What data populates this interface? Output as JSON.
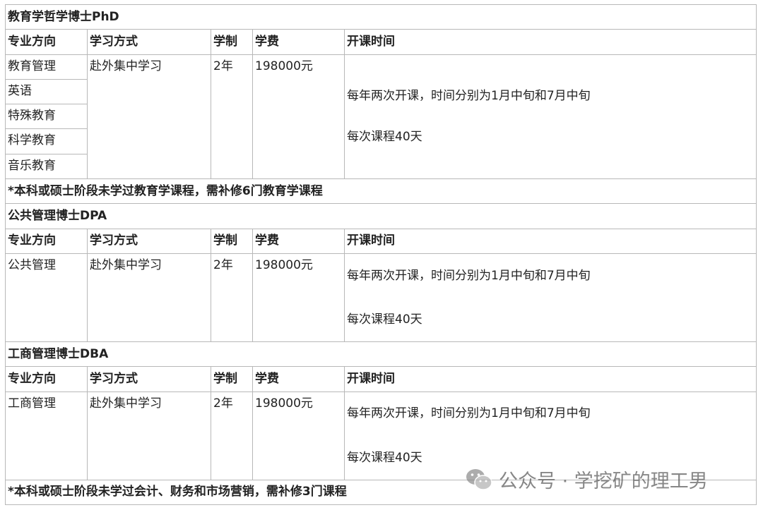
{
  "columns": [
    "专业方向",
    "学习方式",
    "学制",
    "学费",
    "开课时间"
  ],
  "sections": [
    {
      "title": "教育学哲学博士PhD",
      "majors": [
        "教育管理",
        "英语",
        "特殊教育",
        "科学教育",
        "音乐教育"
      ],
      "mode": "赴外集中学习",
      "duration": "2年",
      "fee": "198000元",
      "schedule": [
        "每年两次开课，时间分别为1月中旬和7月中旬",
        "每次课程40天"
      ],
      "note": "*本科或硕士阶段未学过教育学课程，需补修6门教育学课程"
    },
    {
      "title": "公共管理博士DPA",
      "majors": [
        "公共管理"
      ],
      "mode": "赴外集中学习",
      "duration": "2年",
      "fee": "198000元",
      "schedule": [
        "每年两次开课，时间分别为1月中旬和7月中旬",
        "每次课程40天"
      ]
    },
    {
      "title": "工商管理博士DBA",
      "majors": [
        "工商管理"
      ],
      "mode": "赴外集中学习",
      "duration": "2年",
      "fee": "198000元",
      "schedule": [
        "每年两次开课，时间分别为1月中旬和7月中旬",
        "每次课程40天"
      ],
      "note": "*本科或硕士阶段未学过会计、财务和市场营销，需补修3门课程"
    }
  ],
  "watermark": {
    "text": "公众号 · 学挖矿的理工男",
    "icon": "wechat-icon"
  }
}
